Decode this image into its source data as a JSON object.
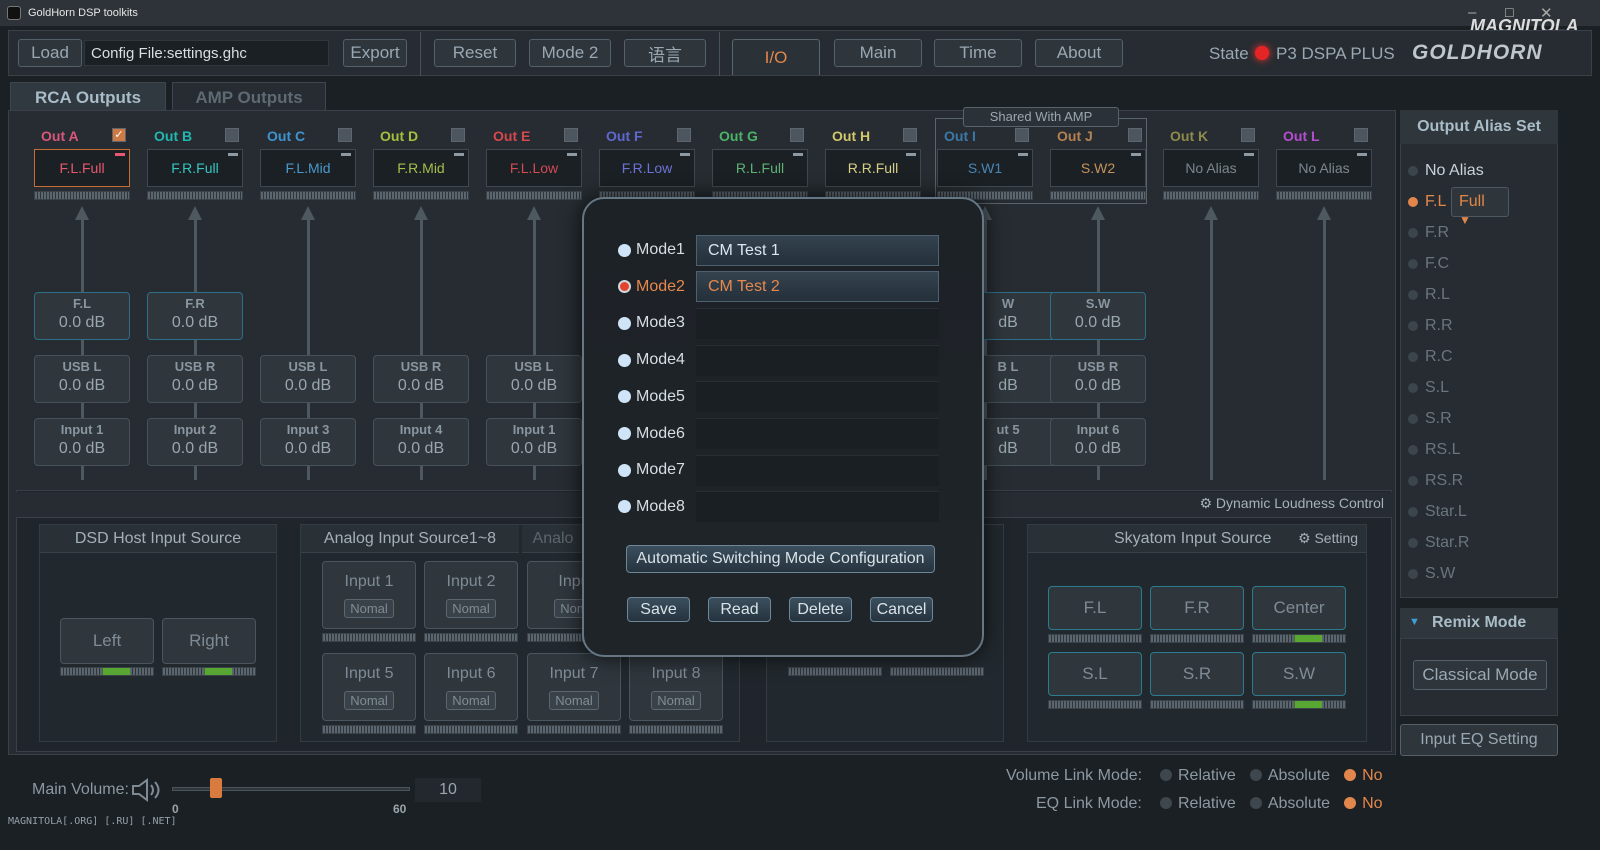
{
  "window": {
    "title": "GoldHorn DSP toolkits",
    "watermark": "MAGNITOLA[.ORG] [.RU] [.NET]",
    "brand_mark": "MAGNITOLA"
  },
  "toolbar": {
    "load": "Load",
    "config_file": "Config File:settings.ghc",
    "export": "Export",
    "reset": "Reset",
    "mode": "Mode 2",
    "language": "语言",
    "tabs": [
      "I/O",
      "Main",
      "Time",
      "About"
    ],
    "state_label": "State",
    "device": "P3 DSPA PLUS",
    "logo": "GOLDHORN"
  },
  "subtabs": [
    "RCA Outputs",
    "AMP Outputs"
  ],
  "shared_label": "Shared With AMP",
  "outputs": [
    {
      "name": "Out A",
      "alias": "F.L.Full",
      "checked": true,
      "color": "#d9577a",
      "alias_color": "#e8596f"
    },
    {
      "name": "Out B",
      "alias": "F.R.Full",
      "checked": false,
      "color": "#22b7b0",
      "alias_color": "#36c6bf"
    },
    {
      "name": "Out C",
      "alias": "F.L.Mid",
      "checked": false,
      "color": "#3e94d0",
      "alias_color": "#4a98cc"
    },
    {
      "name": "Out D",
      "alias": "F.R.Mid",
      "checked": false,
      "color": "#a4c13c",
      "alias_color": "#a6be4a"
    },
    {
      "name": "Out E",
      "alias": "F.L.Low",
      "checked": false,
      "color": "#d6484d",
      "alias_color": "#d34a55"
    },
    {
      "name": "Out F",
      "alias": "F.R.Low",
      "checked": false,
      "color": "#5f68d1",
      "alias_color": "#6c73d6"
    },
    {
      "name": "Out G",
      "alias": "R.L.Full",
      "checked": false,
      "color": "#4db368",
      "alias_color": "#5fb274"
    },
    {
      "name": "Out H",
      "alias": "R.R.Full",
      "checked": false,
      "color": "#d3c86a",
      "alias_color": "#d8cf86"
    },
    {
      "name": "Out I",
      "alias": "S.W1",
      "checked": false,
      "color": "#3c79a8",
      "alias_color": "#4986b8"
    },
    {
      "name": "Out J",
      "alias": "S.W2",
      "checked": false,
      "color": "#b58152",
      "alias_color": "#c4925e"
    },
    {
      "name": "Out K",
      "alias": "No Alias",
      "checked": false,
      "color": "#8e8b4c",
      "alias_color": "#7c878f"
    },
    {
      "name": "Out L",
      "alias": "No Alias",
      "checked": false,
      "color": "#b44ed0",
      "alias_color": "#7c878f"
    }
  ],
  "routes": {
    "row1": [
      {
        "label": "F.L",
        "value": "0.0 dB"
      },
      {
        "label": "F.R",
        "value": "0.0 dB"
      },
      {
        "label": "W",
        "value": "dB"
      },
      {
        "label": "S.W",
        "value": "0.0 dB"
      }
    ],
    "row2": [
      {
        "label": "USB L",
        "value": "0.0 dB"
      },
      {
        "label": "USB R",
        "value": "0.0 dB"
      },
      {
        "label": "USB L",
        "value": "0.0 dB"
      },
      {
        "label": "USB R",
        "value": "0.0 dB"
      },
      {
        "label": "USB L",
        "value": "0.0 dB"
      },
      {
        "label": "B L",
        "value": "dB"
      },
      {
        "label": "USB R",
        "value": "0.0 dB"
      }
    ],
    "row3": [
      {
        "label": "Input 1",
        "value": "0.0 dB"
      },
      {
        "label": "Input 2",
        "value": "0.0 dB"
      },
      {
        "label": "Input 3",
        "value": "0.0 dB"
      },
      {
        "label": "Input 4",
        "value": "0.0 dB"
      },
      {
        "label": "Input 1",
        "value": "0.0 dB"
      },
      {
        "label": "ut 5",
        "value": "dB"
      },
      {
        "label": "Input 6",
        "value": "0.0 dB"
      }
    ]
  },
  "dlc": "Dynamic Loudness Control",
  "dsd": {
    "title": "DSD Host Input Source",
    "left": "Left",
    "right": "Right"
  },
  "analog": {
    "title": "Analog Input Source1~8",
    "tab2": "Analo",
    "inputs": [
      "Input 1",
      "Input 2",
      "Inpu",
      "Input 5",
      "Input 6",
      "Input 7",
      "Input 8"
    ],
    "mode": "Nomal",
    "mode_partial": "Nom"
  },
  "skyatom": {
    "title": "Skyatom Input Source",
    "setting": "Setting",
    "buttons": [
      "F.L",
      "F.R",
      "Center",
      "S.L",
      "S.R",
      "S.W"
    ]
  },
  "alias_set": {
    "title": "Output Alias Set",
    "items": [
      "No Alias",
      "F.L",
      "F.R",
      "F.C",
      "R.L",
      "R.R",
      "R.C",
      "S.L",
      "S.R",
      "RS.L",
      "RS.R",
      "Star.L",
      "Star.R",
      "S.W"
    ],
    "selected": "F.L",
    "full": "Full"
  },
  "remix": {
    "title": "Remix Mode",
    "value": "Classical Mode"
  },
  "input_eq": "Input EQ Setting",
  "volume": {
    "label": "Main Volume:",
    "min": "0",
    "max": "60",
    "value": "10",
    "level": 0.1667
  },
  "link": {
    "volume_label": "Volume Link Mode:",
    "eq_label": "EQ Link Mode:",
    "options": [
      "Relative",
      "Absolute",
      "No"
    ],
    "selected": "No"
  },
  "modal": {
    "modes": [
      {
        "label": "Mode1",
        "name": "CM Test 1"
      },
      {
        "label": "Mode2",
        "name": "CM Test 2"
      },
      {
        "label": "Mode3",
        "name": ""
      },
      {
        "label": "Mode4",
        "name": ""
      },
      {
        "label": "Mode5",
        "name": ""
      },
      {
        "label": "Mode6",
        "name": ""
      },
      {
        "label": "Mode7",
        "name": ""
      },
      {
        "label": "Mode8",
        "name": ""
      }
    ],
    "selected": "Mode2",
    "auto": "Automatic Switching Mode Configuration",
    "save": "Save",
    "read": "Read",
    "delete": "Delete",
    "cancel": "Cancel"
  }
}
